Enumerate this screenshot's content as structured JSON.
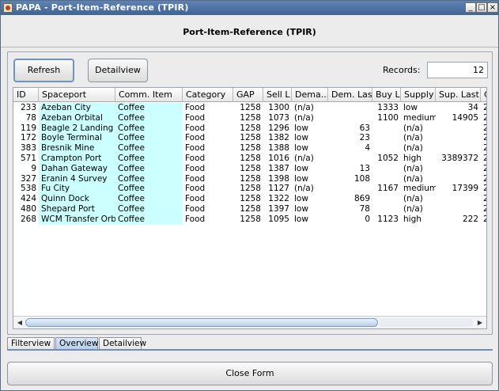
{
  "window": {
    "title": "PAPA - Port-Item-Reference (TPIR)",
    "minimize_glyph": "_",
    "maximize_glyph": "□",
    "close_glyph": "×"
  },
  "form": {
    "title": "Port-Item-Reference (TPIR)"
  },
  "toolbar": {
    "refresh_label": "Refresh",
    "detailview_label": "Detailview",
    "records_label": "Records:",
    "records_value": "12"
  },
  "table": {
    "columns": [
      "ID",
      "Spaceport",
      "Comm. Item",
      "Category",
      "GAP",
      "Sell L",
      "Dema...",
      "Dem. Last",
      "Buy L",
      "Supply",
      "Sup. Last",
      "C"
    ],
    "rows": [
      [
        "233",
        "Azeban City",
        "Coffee",
        "Food",
        "1258",
        "1300",
        "(n/a)",
        "",
        "1333",
        "low",
        "34",
        "2"
      ],
      [
        "78",
        "Azeban Orbital",
        "Coffee",
        "Food",
        "1258",
        "1073",
        "(n/a)",
        "",
        "1100",
        "medium",
        "14905",
        "2"
      ],
      [
        "119",
        "Beagle 2 Landing",
        "Coffee",
        "Food",
        "1258",
        "1296",
        "low",
        "63",
        "",
        "(n/a)",
        "",
        "2"
      ],
      [
        "172",
        "Boyle Terminal",
        "Coffee",
        "Food",
        "1258",
        "1382",
        "low",
        "23",
        "",
        "(n/a)",
        "",
        "2"
      ],
      [
        "383",
        "Bresnik Mine",
        "Coffee",
        "Food",
        "1258",
        "1388",
        "low",
        "4",
        "",
        "(n/a)",
        "",
        "2"
      ],
      [
        "571",
        "Crampton Port",
        "Coffee",
        "Food",
        "1258",
        "1016",
        "(n/a)",
        "",
        "1052",
        "high",
        "3389372",
        "2"
      ],
      [
        "9",
        "Dahan Gateway",
        "Coffee",
        "Food",
        "1258",
        "1387",
        "low",
        "13",
        "",
        "(n/a)",
        "",
        "2"
      ],
      [
        "327",
        "Eranin 4 Survey",
        "Coffee",
        "Food",
        "1258",
        "1398",
        "low",
        "108",
        "",
        "(n/a)",
        "",
        "2"
      ],
      [
        "538",
        "Fu City",
        "Coffee",
        "Food",
        "1258",
        "1127",
        "(n/a)",
        "",
        "1167",
        "medium",
        "17399",
        "2"
      ],
      [
        "424",
        "Quinn Dock",
        "Coffee",
        "Food",
        "1258",
        "1322",
        "low",
        "869",
        "",
        "(n/a)",
        "",
        "2"
      ],
      [
        "480",
        "Shepard Port",
        "Coffee",
        "Food",
        "1258",
        "1397",
        "low",
        "78",
        "",
        "(n/a)",
        "",
        "2"
      ],
      [
        "268",
        "WCM Transfer Orb...",
        "Coffee",
        "Food",
        "1258",
        "1095",
        "low",
        "0",
        "1123",
        "high",
        "222",
        "2"
      ]
    ]
  },
  "tabs": [
    "Filterview",
    "Overview",
    "Detailview"
  ],
  "active_tab": "Overview",
  "footer": {
    "close_label": "Close Form"
  },
  "colors": {
    "title_bar": "#3e6395",
    "highlight_cells": "#ccffff",
    "active_tab": "#b7cfea"
  }
}
